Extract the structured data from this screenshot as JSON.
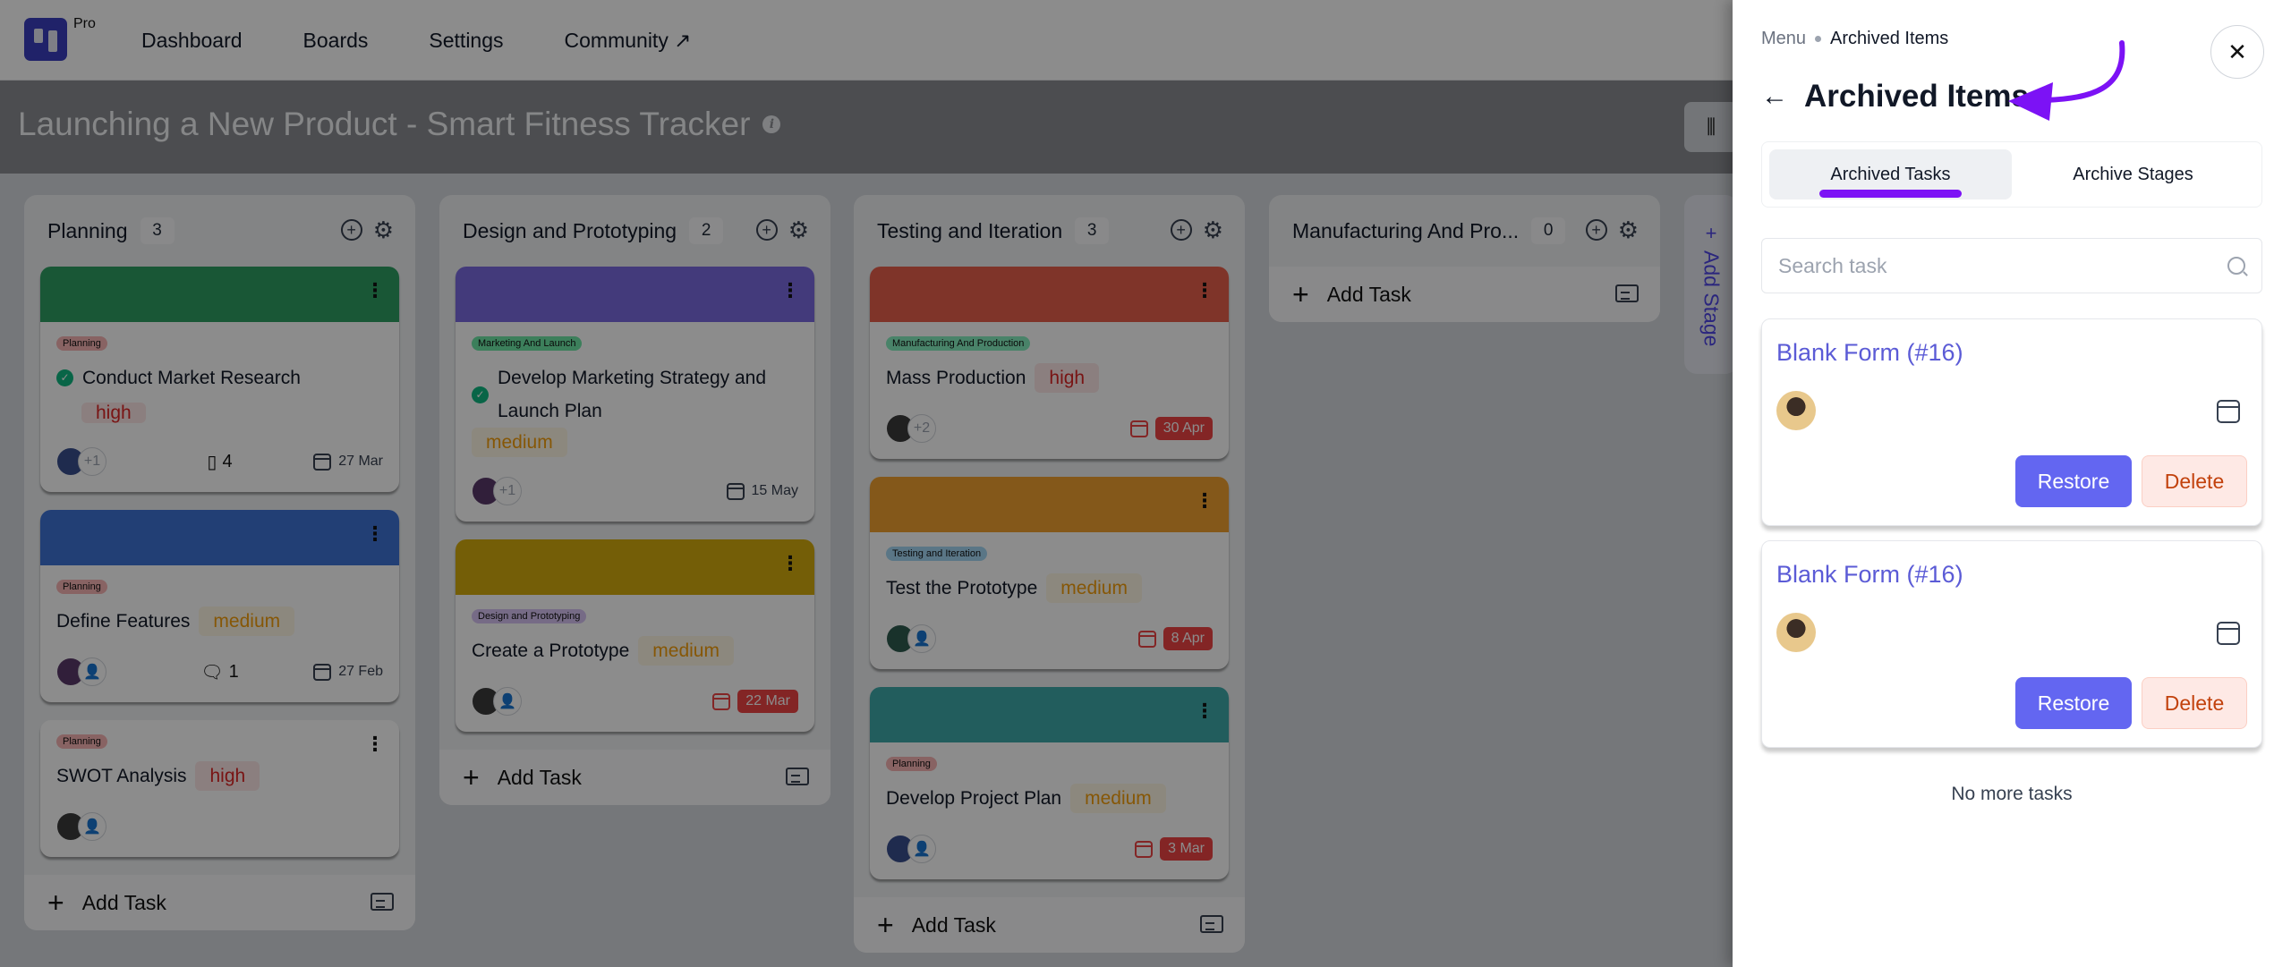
{
  "app": {
    "plan_badge": "Pro",
    "nav": [
      "Dashboard",
      "Boards",
      "Settings",
      "Community ↗"
    ]
  },
  "board": {
    "title": "Launching a New Product - Smart Fitness Tracker",
    "add_stage_label": "Add Stage",
    "stages": [
      {
        "name": "Planning",
        "count": "3",
        "add_task_label": "Add Task",
        "cards": [
          {
            "cover": "#2e9e63",
            "tag": "Planning",
            "tag_color": "#f8b4b4",
            "title": "Conduct Market Research",
            "completed": true,
            "priority": "high",
            "avatars_more": "+1",
            "meta_icon": "notebook-icon",
            "meta_value": "4",
            "due": "27 Mar",
            "overdue": false
          },
          {
            "cover": "#3f73d6",
            "tag": "Planning",
            "tag_color": "#f8b4b4",
            "title": "Define Features",
            "completed": false,
            "priority": "medium",
            "avatars_more": "",
            "meta_icon": "comment-icon",
            "meta_value": "1",
            "due": "27 Feb",
            "overdue": false
          },
          {
            "cover": "",
            "tag": "Planning",
            "tag_color": "#f8b4b4",
            "title": "SWOT Analysis",
            "completed": false,
            "priority": "high",
            "avatars_more": "",
            "meta_icon": "",
            "meta_value": "",
            "due": "",
            "overdue": false
          }
        ]
      },
      {
        "name": "Design and Prototyping",
        "count": "2",
        "add_task_label": "Add Task",
        "cards": [
          {
            "cover": "#7b6be0",
            "tag": "Marketing And Launch",
            "tag_color": "#6ee7a7",
            "title": "Develop Marketing Strategy and Launch Plan",
            "completed": true,
            "priority": "medium",
            "avatars_more": "+1",
            "meta_icon": "",
            "meta_value": "",
            "due": "15 May",
            "overdue": false
          },
          {
            "cover": "#d4ac0d",
            "tag": "Design and Prototyping",
            "tag_color": "#d8c4f5",
            "title": "Create a Prototype",
            "completed": false,
            "priority": "medium",
            "avatars_more": "",
            "meta_icon": "",
            "meta_value": "",
            "due": "22 Mar",
            "overdue": true
          }
        ]
      },
      {
        "name": "Testing and Iteration",
        "count": "3",
        "add_task_label": "Add Task",
        "cards": [
          {
            "cover": "#e8604c",
            "tag": "Manufacturing And Production",
            "tag_color": "#86efbf",
            "title": "Mass Production",
            "completed": false,
            "priority": "high",
            "avatars_more": "+2",
            "meta_icon": "",
            "meta_value": "",
            "due": "30 Apr",
            "overdue": true
          },
          {
            "cover": "#f0a030",
            "tag": "Testing and Iteration",
            "tag_color": "#a5d8f5",
            "title": "Test the Prototype",
            "completed": false,
            "priority": "medium",
            "avatars_more": "",
            "meta_icon": "",
            "meta_value": "",
            "due": "8 Apr",
            "overdue": true
          },
          {
            "cover": "#3fa9a9",
            "tag": "Planning",
            "tag_color": "#f8b4b4",
            "title": "Develop Project Plan",
            "completed": false,
            "priority": "medium",
            "avatars_more": "",
            "meta_icon": "",
            "meta_value": "",
            "due": "3 Mar",
            "overdue": true
          }
        ]
      },
      {
        "name": "Manufacturing And Pro...",
        "count": "0",
        "add_task_label": "Add Task",
        "cards": []
      }
    ]
  },
  "panel": {
    "breadcrumb": {
      "root": "Menu",
      "current": "Archived Items"
    },
    "title": "Archived Items",
    "tabs": [
      {
        "label": "Archived Tasks",
        "active": true
      },
      {
        "label": "Archive Stages",
        "active": false
      }
    ],
    "search": {
      "placeholder": "Search task",
      "value": ""
    },
    "items": [
      {
        "title": "Blank Form (#16)",
        "restore_label": "Restore",
        "delete_label": "Delete"
      },
      {
        "title": "Blank Form (#16)",
        "restore_label": "Restore",
        "delete_label": "Delete"
      }
    ],
    "footer_text": "No more tasks",
    "accent": "#7c12f5",
    "primary": "#6366f1"
  }
}
